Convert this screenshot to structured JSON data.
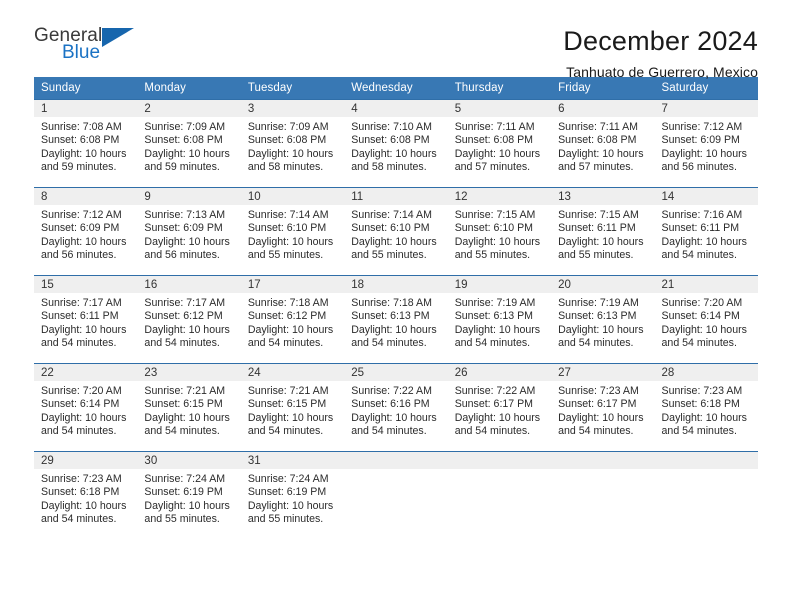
{
  "logo": {
    "word_top": "General",
    "word_bottom": "Blue",
    "triangle_color": "#1766ad",
    "blue_color": "#1a72c4"
  },
  "header": {
    "title": "December 2024",
    "subtitle": "Tanhuato de Guerrero, Mexico"
  },
  "colors": {
    "header_row_bg": "#3878b4",
    "daynum_bg": "#efefef",
    "row_border": "#2f6ea8",
    "text": "#2b2b2b"
  },
  "weekday_headers": [
    "Sunday",
    "Monday",
    "Tuesday",
    "Wednesday",
    "Thursday",
    "Friday",
    "Saturday"
  ],
  "weeks": [
    [
      {
        "day": "1",
        "sunrise": "Sunrise: 7:08 AM",
        "sunset": "Sunset: 6:08 PM",
        "daylight": "Daylight: 10 hours and 59 minutes."
      },
      {
        "day": "2",
        "sunrise": "Sunrise: 7:09 AM",
        "sunset": "Sunset: 6:08 PM",
        "daylight": "Daylight: 10 hours and 59 minutes."
      },
      {
        "day": "3",
        "sunrise": "Sunrise: 7:09 AM",
        "sunset": "Sunset: 6:08 PM",
        "daylight": "Daylight: 10 hours and 58 minutes."
      },
      {
        "day": "4",
        "sunrise": "Sunrise: 7:10 AM",
        "sunset": "Sunset: 6:08 PM",
        "daylight": "Daylight: 10 hours and 58 minutes."
      },
      {
        "day": "5",
        "sunrise": "Sunrise: 7:11 AM",
        "sunset": "Sunset: 6:08 PM",
        "daylight": "Daylight: 10 hours and 57 minutes."
      },
      {
        "day": "6",
        "sunrise": "Sunrise: 7:11 AM",
        "sunset": "Sunset: 6:08 PM",
        "daylight": "Daylight: 10 hours and 57 minutes."
      },
      {
        "day": "7",
        "sunrise": "Sunrise: 7:12 AM",
        "sunset": "Sunset: 6:09 PM",
        "daylight": "Daylight: 10 hours and 56 minutes."
      }
    ],
    [
      {
        "day": "8",
        "sunrise": "Sunrise: 7:12 AM",
        "sunset": "Sunset: 6:09 PM",
        "daylight": "Daylight: 10 hours and 56 minutes."
      },
      {
        "day": "9",
        "sunrise": "Sunrise: 7:13 AM",
        "sunset": "Sunset: 6:09 PM",
        "daylight": "Daylight: 10 hours and 56 minutes."
      },
      {
        "day": "10",
        "sunrise": "Sunrise: 7:14 AM",
        "sunset": "Sunset: 6:10 PM",
        "daylight": "Daylight: 10 hours and 55 minutes."
      },
      {
        "day": "11",
        "sunrise": "Sunrise: 7:14 AM",
        "sunset": "Sunset: 6:10 PM",
        "daylight": "Daylight: 10 hours and 55 minutes."
      },
      {
        "day": "12",
        "sunrise": "Sunrise: 7:15 AM",
        "sunset": "Sunset: 6:10 PM",
        "daylight": "Daylight: 10 hours and 55 minutes."
      },
      {
        "day": "13",
        "sunrise": "Sunrise: 7:15 AM",
        "sunset": "Sunset: 6:11 PM",
        "daylight": "Daylight: 10 hours and 55 minutes."
      },
      {
        "day": "14",
        "sunrise": "Sunrise: 7:16 AM",
        "sunset": "Sunset: 6:11 PM",
        "daylight": "Daylight: 10 hours and 54 minutes."
      }
    ],
    [
      {
        "day": "15",
        "sunrise": "Sunrise: 7:17 AM",
        "sunset": "Sunset: 6:11 PM",
        "daylight": "Daylight: 10 hours and 54 minutes."
      },
      {
        "day": "16",
        "sunrise": "Sunrise: 7:17 AM",
        "sunset": "Sunset: 6:12 PM",
        "daylight": "Daylight: 10 hours and 54 minutes."
      },
      {
        "day": "17",
        "sunrise": "Sunrise: 7:18 AM",
        "sunset": "Sunset: 6:12 PM",
        "daylight": "Daylight: 10 hours and 54 minutes."
      },
      {
        "day": "18",
        "sunrise": "Sunrise: 7:18 AM",
        "sunset": "Sunset: 6:13 PM",
        "daylight": "Daylight: 10 hours and 54 minutes."
      },
      {
        "day": "19",
        "sunrise": "Sunrise: 7:19 AM",
        "sunset": "Sunset: 6:13 PM",
        "daylight": "Daylight: 10 hours and 54 minutes."
      },
      {
        "day": "20",
        "sunrise": "Sunrise: 7:19 AM",
        "sunset": "Sunset: 6:13 PM",
        "daylight": "Daylight: 10 hours and 54 minutes."
      },
      {
        "day": "21",
        "sunrise": "Sunrise: 7:20 AM",
        "sunset": "Sunset: 6:14 PM",
        "daylight": "Daylight: 10 hours and 54 minutes."
      }
    ],
    [
      {
        "day": "22",
        "sunrise": "Sunrise: 7:20 AM",
        "sunset": "Sunset: 6:14 PM",
        "daylight": "Daylight: 10 hours and 54 minutes."
      },
      {
        "day": "23",
        "sunrise": "Sunrise: 7:21 AM",
        "sunset": "Sunset: 6:15 PM",
        "daylight": "Daylight: 10 hours and 54 minutes."
      },
      {
        "day": "24",
        "sunrise": "Sunrise: 7:21 AM",
        "sunset": "Sunset: 6:15 PM",
        "daylight": "Daylight: 10 hours and 54 minutes."
      },
      {
        "day": "25",
        "sunrise": "Sunrise: 7:22 AM",
        "sunset": "Sunset: 6:16 PM",
        "daylight": "Daylight: 10 hours and 54 minutes."
      },
      {
        "day": "26",
        "sunrise": "Sunrise: 7:22 AM",
        "sunset": "Sunset: 6:17 PM",
        "daylight": "Daylight: 10 hours and 54 minutes."
      },
      {
        "day": "27",
        "sunrise": "Sunrise: 7:23 AM",
        "sunset": "Sunset: 6:17 PM",
        "daylight": "Daylight: 10 hours and 54 minutes."
      },
      {
        "day": "28",
        "sunrise": "Sunrise: 7:23 AM",
        "sunset": "Sunset: 6:18 PM",
        "daylight": "Daylight: 10 hours and 54 minutes."
      }
    ],
    [
      {
        "day": "29",
        "sunrise": "Sunrise: 7:23 AM",
        "sunset": "Sunset: 6:18 PM",
        "daylight": "Daylight: 10 hours and 54 minutes."
      },
      {
        "day": "30",
        "sunrise": "Sunrise: 7:24 AM",
        "sunset": "Sunset: 6:19 PM",
        "daylight": "Daylight: 10 hours and 55 minutes."
      },
      {
        "day": "31",
        "sunrise": "Sunrise: 7:24 AM",
        "sunset": "Sunset: 6:19 PM",
        "daylight": "Daylight: 10 hours and 55 minutes."
      },
      {
        "day": "",
        "sunrise": "",
        "sunset": "",
        "daylight": ""
      },
      {
        "day": "",
        "sunrise": "",
        "sunset": "",
        "daylight": ""
      },
      {
        "day": "",
        "sunrise": "",
        "sunset": "",
        "daylight": ""
      },
      {
        "day": "",
        "sunrise": "",
        "sunset": "",
        "daylight": ""
      }
    ]
  ]
}
